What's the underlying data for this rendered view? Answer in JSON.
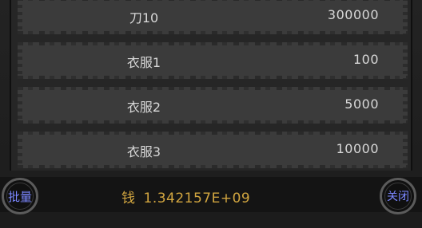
{
  "items": [
    {
      "name": "刀10",
      "value": "300000"
    },
    {
      "name": "衣服1",
      "value": "100"
    },
    {
      "name": "衣服2",
      "value": "5000"
    },
    {
      "name": "衣服3",
      "value": "10000"
    }
  ],
  "footer": {
    "money_label": "钱",
    "money_value": "1.342157E+09",
    "batch_label": "批量",
    "close_label": "关闭"
  },
  "colors": {
    "money": "#d2a640",
    "button_text": "#7b87ff",
    "row_bg": "#3b3b3b"
  }
}
